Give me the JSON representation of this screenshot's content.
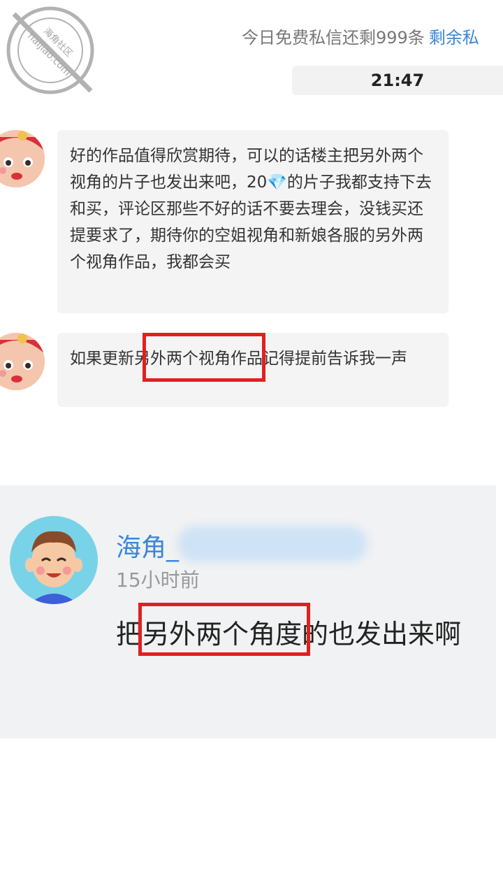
{
  "header": {
    "free_message_notice": "今日免费私信还剩999条",
    "remaining_link": "剩余私"
  },
  "conversation": {
    "timestamp": "21:47",
    "messages": [
      {
        "text_before": "好的作品值得欣赏期待，可以的话楼主把另外两个视角的片子也发出来吧，20",
        "gem": "💎",
        "text_after": "的片子我都支持下去和买，评论区那些不好的话不要去理会，没钱买还提要求了，期待你的空姐视角和新娘各服的另外两个视角作品，我都会买"
      },
      {
        "text": "如果更新另外两个视角作品记得提前告诉我一声"
      }
    ]
  },
  "comment": {
    "username": "海角_",
    "time": "15小时前",
    "text": "把另外两个角度的也发出来啊"
  },
  "watermark": {
    "name": "海角社区",
    "site": "haijiao.com"
  },
  "colors": {
    "link": "#3a86d8",
    "highlight": "#e02020",
    "bubble": "#f4f4f4",
    "panel": "#f1f2f3"
  }
}
